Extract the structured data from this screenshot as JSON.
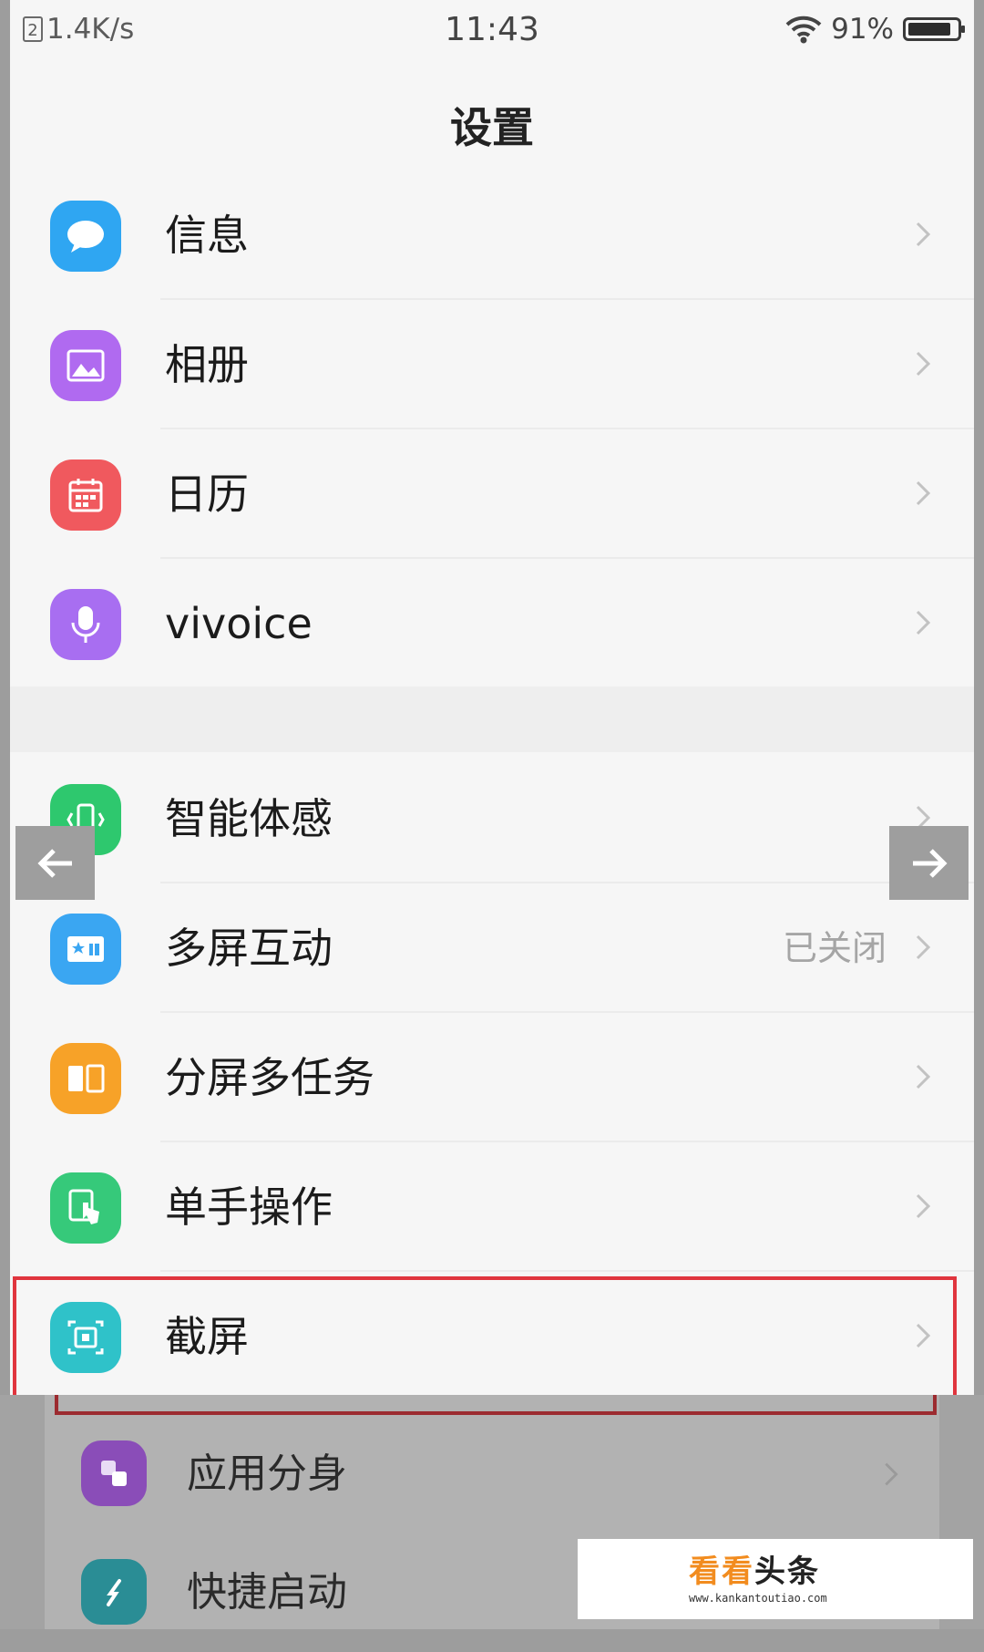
{
  "status_bar": {
    "sim_label": "2",
    "net_speed": "1.4K/s",
    "time": "11:43",
    "battery_percent": "91%",
    "battery_level": 0.91
  },
  "header": {
    "title": "设置"
  },
  "group1": [
    {
      "label": "信息",
      "icon": "message-icon",
      "color": "#2fa6f2"
    },
    {
      "label": "相册",
      "icon": "album-icon",
      "color": "#b06af0"
    },
    {
      "label": "日历",
      "icon": "calendar-icon",
      "color": "#f0595e"
    },
    {
      "label": "vivoice",
      "icon": "microphone-icon",
      "color": "#a86ef1"
    }
  ],
  "group2": [
    {
      "label": "智能体感",
      "icon": "smart-motion-icon",
      "color": "#2ec86e",
      "status": ""
    },
    {
      "label": "多屏互动",
      "icon": "multi-screen-icon",
      "color": "#3aa6f2",
      "status": "已关闭"
    },
    {
      "label": "分屏多任务",
      "icon": "split-screen-icon",
      "color": "#f7a228",
      "status": ""
    },
    {
      "label": "单手操作",
      "icon": "one-hand-icon",
      "color": "#36c97a",
      "status": ""
    },
    {
      "label": "截屏",
      "icon": "screenshot-icon",
      "color": "#2fc2c9",
      "status": ""
    }
  ],
  "group3": [
    {
      "label": "应用分身",
      "icon": "app-clone-icon",
      "color": "#8a4db8"
    },
    {
      "label": "快捷启动",
      "icon": "quick-launch-icon",
      "color": "#2a8d95"
    }
  ],
  "watermark": {
    "brand_orange": "看看",
    "brand_dark": "头条",
    "url": "www.kankantoutiao.com"
  }
}
